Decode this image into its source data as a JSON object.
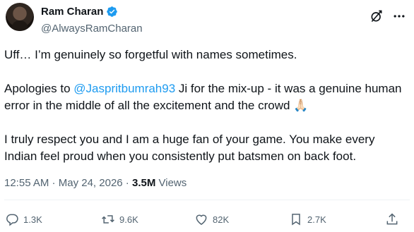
{
  "author": {
    "name": "Ram Charan",
    "handle": "@AlwaysRamCharan"
  },
  "tweet": {
    "line1": "Uff… I’m genuinely so forgetful with names sometimes.",
    "line2_prefix": "Apologies to ",
    "mention": "@Jaspritbumrah93",
    "line2_suffix": " Ji for the mix-up - it was a genuine human error in the middle of all the excitement and the crowd ",
    "emoji": "🙏🏻",
    "line3": "I truly respect you and I am a huge fan of your game. You make every Indian feel proud when you consistently put batsmen on back foot."
  },
  "meta": {
    "time": "12:55 AM",
    "sep1": " · ",
    "date": "May 24, 2026",
    "sep2": " · ",
    "views_count": "3.5M",
    "views_label": " Views"
  },
  "actions": {
    "replies": "1.3K",
    "reposts": "9.6K",
    "likes": "82K",
    "bookmarks": "2.7K"
  },
  "colors": {
    "accent": "#1d9bf0",
    "text": "#0f1419",
    "secondary": "#536471"
  }
}
